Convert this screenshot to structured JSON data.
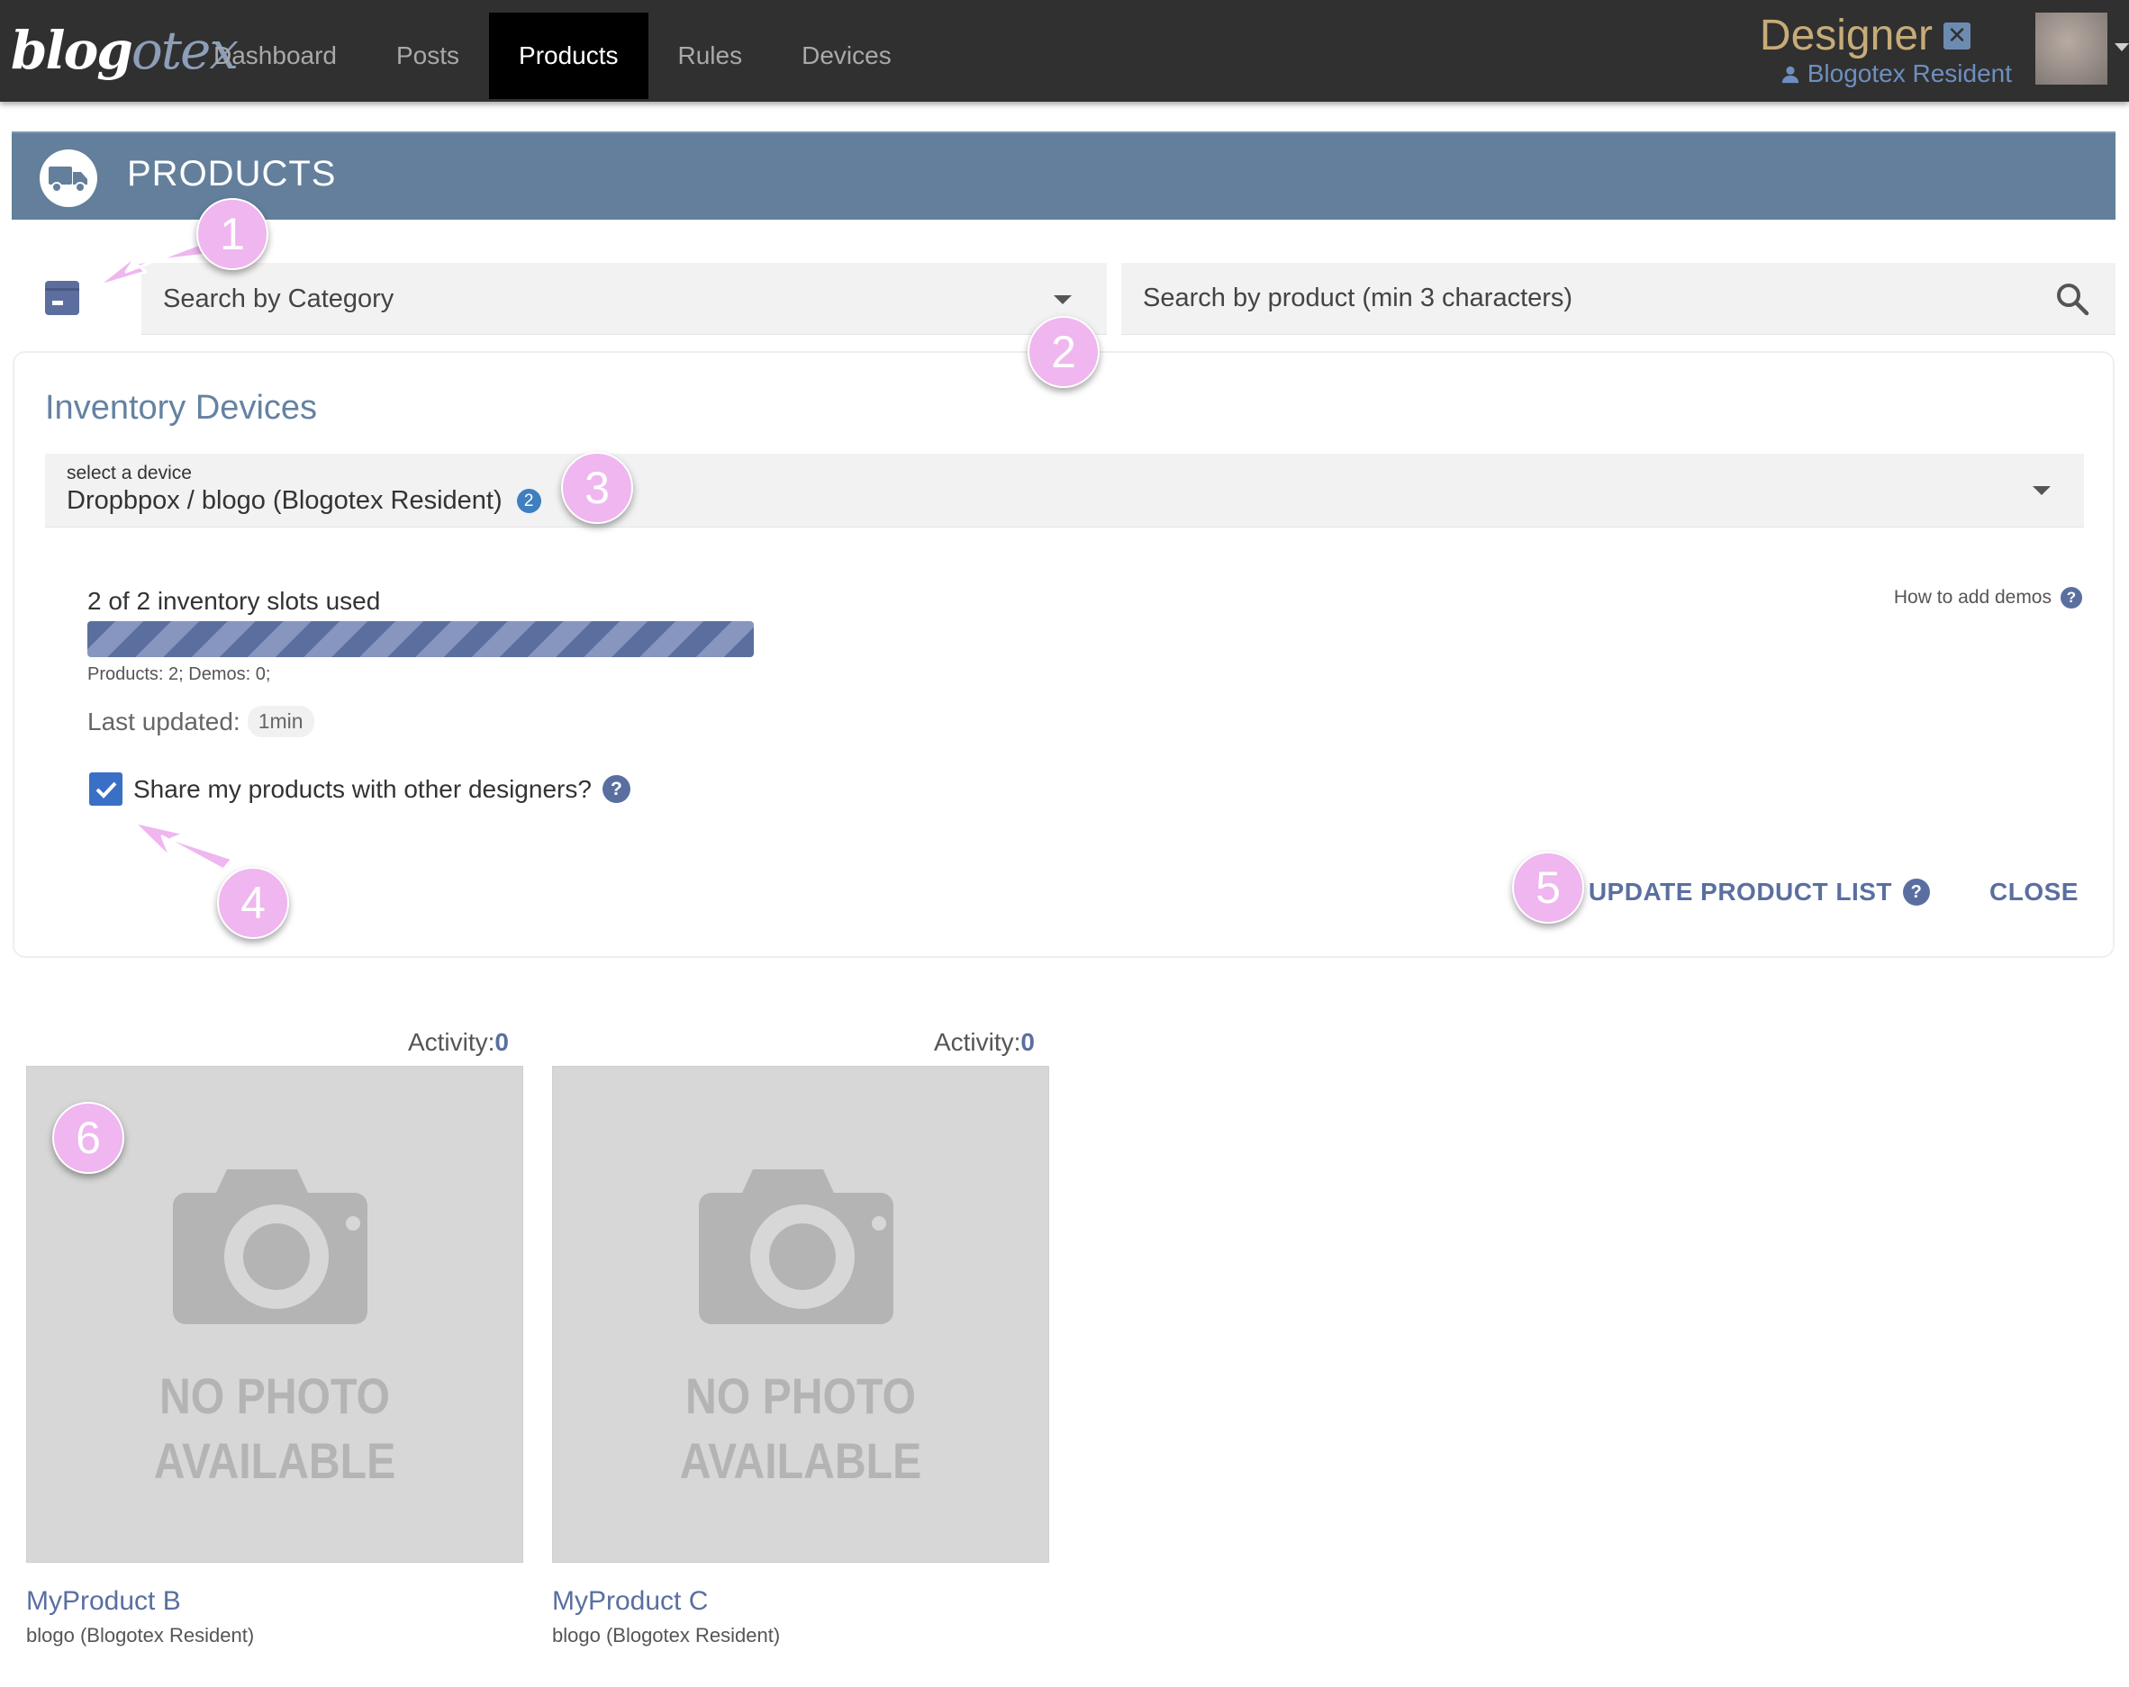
{
  "app": {
    "logo_part1": "blog",
    "logo_part2": "otex"
  },
  "nav": {
    "items": [
      {
        "label": "Dashboard",
        "active": false
      },
      {
        "label": "Posts",
        "active": false
      },
      {
        "label": "Products",
        "active": true
      },
      {
        "label": "Rules",
        "active": false
      },
      {
        "label": "Devices",
        "active": false
      }
    ]
  },
  "user": {
    "role": "Designer",
    "role_close_icon": "close-icon",
    "name": "Blogotex Resident",
    "name_icon": "person-icon"
  },
  "page": {
    "title": "PRODUCTS",
    "icon": "truck-icon"
  },
  "search": {
    "category_placeholder": "Search by Category",
    "product_placeholder": "Search by product (min 3 characters)"
  },
  "inventory": {
    "title": "Inventory Devices",
    "device_label": "select a device",
    "device_value": "Dropbpox / blogo (Blogotex Resident)",
    "device_count": "2",
    "slots_text": "2 of 2 inventory slots used",
    "slots_used": 2,
    "slots_total": 2,
    "slots_detail": "Products: 2; Demos: 0;",
    "how_to_link": "How to add demos",
    "last_updated_label": "Last updated:",
    "last_updated_value": "1min",
    "share_label": "Share my products with other designers?",
    "share_checked": true,
    "update_button": "UPDATE PRODUCT LIST",
    "close_button": "CLOSE"
  },
  "products": [
    {
      "activity_label": "Activity:",
      "activity_value": "0",
      "placeholder_line1": "NO PHOTO",
      "placeholder_line2": "AVAILABLE",
      "name": "MyProduct B",
      "owner": "blogo (Blogotex Resident)"
    },
    {
      "activity_label": "Activity:",
      "activity_value": "0",
      "placeholder_line1": "NO PHOTO",
      "placeholder_line2": "AVAILABLE",
      "name": "MyProduct C",
      "owner": "blogo (Blogotex Resident)"
    }
  ],
  "markers": [
    "1",
    "2",
    "3",
    "4",
    "5",
    "6"
  ],
  "colors": {
    "topbar": "#303030",
    "header": "#637f9b",
    "accent": "#5a6fa0",
    "role": "#c7ac78",
    "marker": "#efb6ef"
  }
}
